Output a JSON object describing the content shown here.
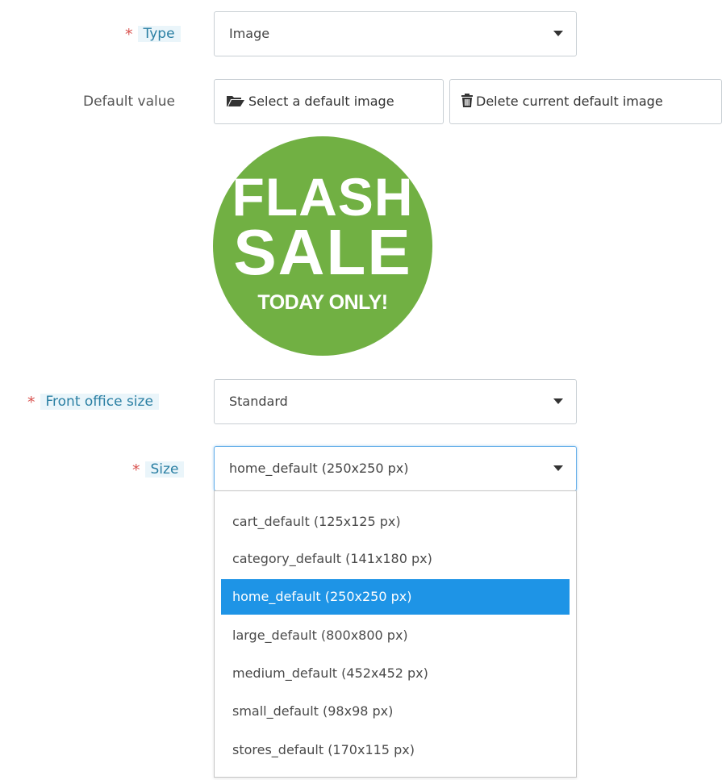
{
  "form": {
    "type": {
      "required_mark": "*",
      "label": "Type",
      "value": "Image"
    },
    "default_value": {
      "label": "Default value",
      "select_button": "Select a default image",
      "delete_button": "Delete current default image"
    },
    "preview": {
      "line1": "FLASH",
      "line2": "SALE",
      "line3": "TODAY ONLY!",
      "color": "#71b043"
    },
    "front_office_size": {
      "required_mark": "*",
      "label": "Front office size",
      "value": "Standard"
    },
    "size": {
      "required_mark": "*",
      "label": "Size",
      "value": "home_default (250x250 px)",
      "options": [
        "cart_default (125x125 px)",
        "category_default (141x180 px)",
        "home_default (250x250 px)",
        "large_default (800x800 px)",
        "medium_default (452x452 px)",
        "small_default (98x98 px)",
        "stores_default (170x115 px)"
      ],
      "selected_index": 2
    }
  },
  "colors": {
    "required": "#d9534f",
    "label_highlight": "#eaf5fa",
    "selected_option": "#1e94e6",
    "focus_border": "#66afe9"
  },
  "icons": {
    "select_button": "folder-open-icon",
    "delete_button": "trash-icon"
  }
}
